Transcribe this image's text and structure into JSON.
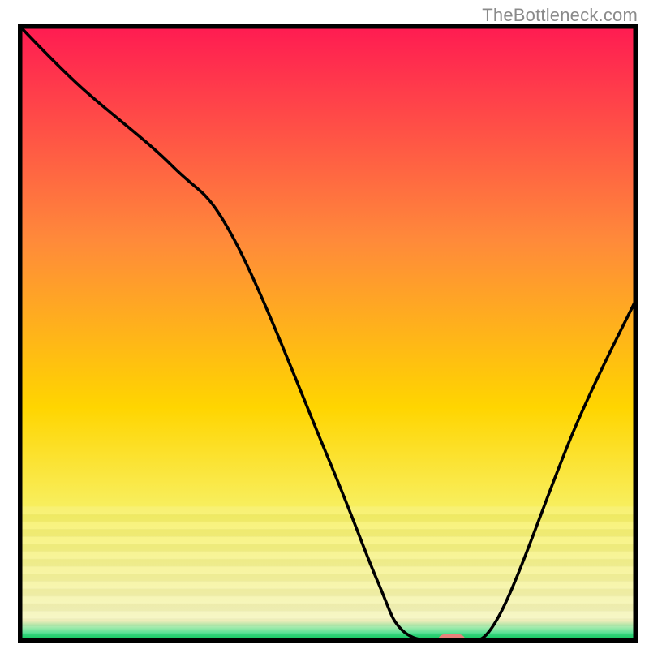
{
  "watermark": "TheBottleneck.com",
  "chart_data": {
    "type": "line",
    "title": "",
    "xlabel": "",
    "ylabel": "",
    "xlim": [
      0,
      100
    ],
    "ylim": [
      0,
      100
    ],
    "x": [
      0,
      10,
      25,
      35,
      50,
      58,
      62,
      68,
      72,
      78,
      90,
      100
    ],
    "values": [
      100,
      90,
      77,
      65,
      30,
      10,
      2,
      0,
      0,
      5,
      35,
      56
    ],
    "curve_color": "#000000",
    "marker": {
      "x": 70,
      "y": 0,
      "color": "#e8807b"
    },
    "background_gradient": {
      "stops": [
        {
          "pos": 0.0,
          "color": "#ff1a52"
        },
        {
          "pos": 0.35,
          "color": "#ff8a3a"
        },
        {
          "pos": 0.62,
          "color": "#ffd500"
        },
        {
          "pos": 0.8,
          "color": "#f7f26a"
        },
        {
          "pos": 0.965,
          "color": "#f5f5c0"
        },
        {
          "pos": 0.985,
          "color": "#3ddc84"
        },
        {
          "pos": 1.0,
          "color": "#00c853"
        }
      ]
    },
    "frame_color": "#000000",
    "frame_stroke_width": 7
  }
}
